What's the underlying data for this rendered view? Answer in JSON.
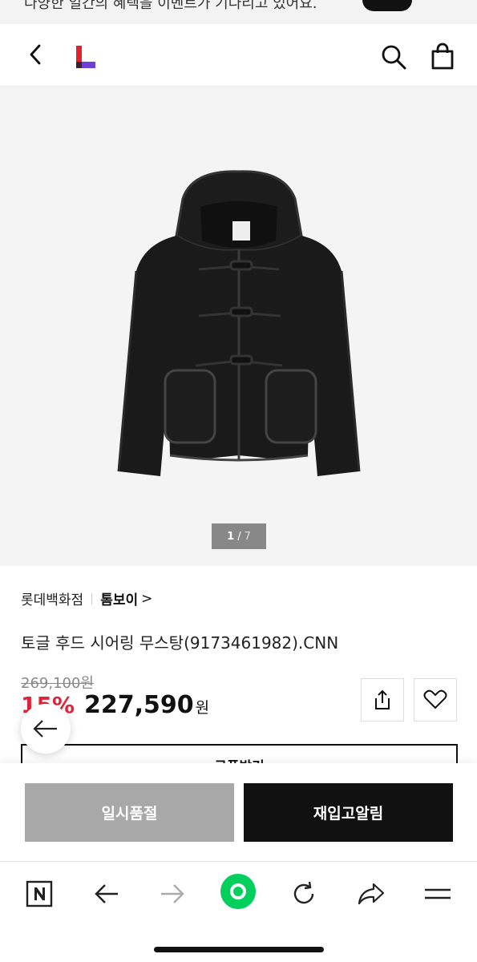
{
  "banner": {
    "text": "다양한 일간의 혜택을 이벤트가 기다리고 있어요."
  },
  "header": {
    "logo_letter": "L",
    "brand_colors": {
      "red": "#e5202e",
      "purple": "#6e3fd6"
    }
  },
  "gallery": {
    "current_page": "1",
    "separator": "/",
    "total_pages": "7",
    "image_alt": "hooded toggle shearling coat"
  },
  "product": {
    "store": "롯데백화점",
    "brand": "톰보이",
    "brand_chevron": ">",
    "name": "토글 후드 시어링 무스탕(9173461982).CNN",
    "original_price": "269,100원",
    "discount": "15%",
    "price": "227,590",
    "currency": "원"
  },
  "coupon": {
    "label": "쿠폰받기"
  },
  "actions": {
    "soldout_label": "일시품절",
    "restock_label": "재입고알림"
  },
  "colors": {
    "discount_red": "#e0243a",
    "soldout_gray": "#a8a8a8",
    "primary_black": "#111111",
    "naver_green": "#03cf5d"
  },
  "browser": {
    "n_icon_label": "N"
  }
}
